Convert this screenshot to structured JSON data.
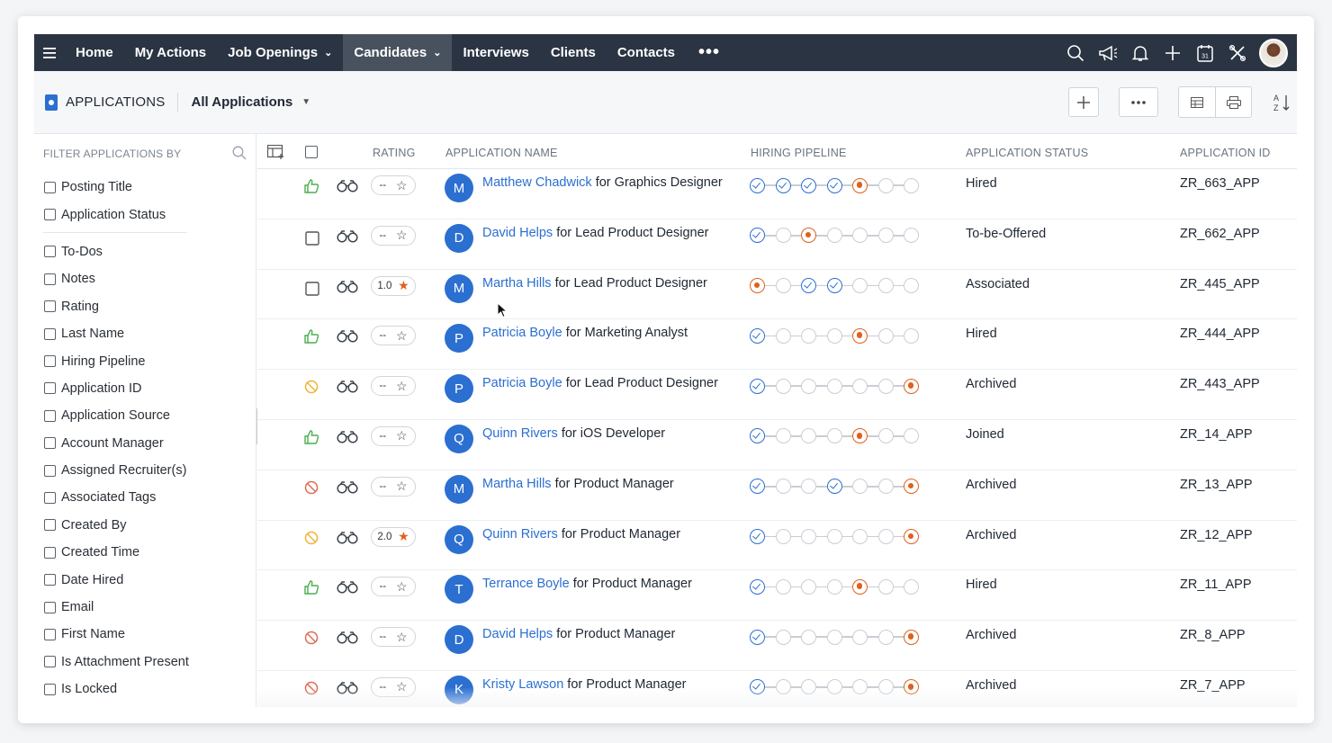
{
  "nav": {
    "items": [
      {
        "label": "Home"
      },
      {
        "label": "My Actions"
      },
      {
        "label": "Job Openings"
      },
      {
        "label": "Candidates"
      },
      {
        "label": "Interviews"
      },
      {
        "label": "Clients"
      },
      {
        "label": "Contacts"
      }
    ],
    "more_label": "•••",
    "active": "Candidates",
    "icons": [
      "search-icon",
      "announcement-icon",
      "bell-icon",
      "plus-icon",
      "calendar-icon",
      "tools-icon"
    ],
    "calendar_day": "31"
  },
  "toolbar": {
    "module_title": "APPLICATIONS",
    "view_label": "All Applications"
  },
  "sidebar": {
    "header": "FILTER APPLICATIONS BY",
    "group1": [
      {
        "label": "Posting Title"
      },
      {
        "label": "Application Status"
      }
    ],
    "group2": [
      {
        "label": "To-Dos"
      },
      {
        "label": "Notes"
      },
      {
        "label": "Rating"
      },
      {
        "label": "Last Name"
      },
      {
        "label": "Hiring Pipeline"
      },
      {
        "label": "Application ID"
      },
      {
        "label": "Application Source"
      },
      {
        "label": "Account Manager"
      },
      {
        "label": "Assigned Recruiter(s)"
      },
      {
        "label": "Associated Tags"
      },
      {
        "label": "Created By"
      },
      {
        "label": "Created Time"
      },
      {
        "label": "Date Hired"
      },
      {
        "label": "Email"
      },
      {
        "label": "First Name"
      },
      {
        "label": "Is Attachment Present"
      },
      {
        "label": "Is Locked"
      }
    ]
  },
  "table": {
    "headers": {
      "rating": "RATING",
      "name": "APPLICATION NAME",
      "pipeline": "HIRING PIPELINE",
      "status": "APPLICATION STATUS",
      "id": "APPLICATION ID"
    },
    "for_word": "for",
    "colors": {
      "link": "#2b6fd1",
      "accent": "#e0601c",
      "like": "#4caf50",
      "pending": "#f2b233",
      "reject": "#e06a55"
    },
    "rows": [
      {
        "mark": "like",
        "rating": "--",
        "star": false,
        "initial": "M",
        "candidate": "Matthew Chadwick",
        "job": "Graphics Designer",
        "pipeline": [
          "done",
          "done",
          "done",
          "done",
          "cur",
          "todo",
          "todo"
        ],
        "status": "Hired",
        "id": "ZR_663_APP"
      },
      {
        "mark": "checkbox",
        "rating": "--",
        "star": false,
        "initial": "D",
        "candidate": "David Helps",
        "job": "Lead Product Designer",
        "pipeline": [
          "done",
          "todo",
          "cur",
          "todo",
          "todo",
          "todo",
          "todo"
        ],
        "status": "To-be-Offered",
        "id": "ZR_662_APP"
      },
      {
        "mark": "checkbox",
        "rating": "1.0",
        "star": true,
        "initial": "M",
        "candidate": "Martha Hills",
        "job": "Lead Product Designer",
        "pipeline": [
          "cur",
          "todo",
          "done",
          "done",
          "todo",
          "todo",
          "todo"
        ],
        "status": "Associated",
        "id": "ZR_445_APP"
      },
      {
        "mark": "like",
        "rating": "--",
        "star": false,
        "initial": "P",
        "candidate": "Patricia Boyle",
        "job": "Marketing Analyst",
        "pipeline": [
          "done",
          "todo",
          "todo",
          "todo",
          "cur",
          "todo",
          "todo"
        ],
        "status": "Hired",
        "id": "ZR_444_APP"
      },
      {
        "mark": "pending",
        "rating": "--",
        "star": false,
        "initial": "P",
        "candidate": "Patricia Boyle",
        "job": "Lead Product Designer",
        "pipeline": [
          "done",
          "todo",
          "todo",
          "todo",
          "todo",
          "todo",
          "cur"
        ],
        "status": "Archived",
        "id": "ZR_443_APP"
      },
      {
        "mark": "like",
        "rating": "--",
        "star": false,
        "initial": "Q",
        "candidate": "Quinn Rivers",
        "job": "iOS Developer",
        "pipeline": [
          "done",
          "todo",
          "todo",
          "todo",
          "cur",
          "todo",
          "todo"
        ],
        "status": "Joined",
        "id": "ZR_14_APP"
      },
      {
        "mark": "reject",
        "rating": "--",
        "star": false,
        "initial": "M",
        "candidate": "Martha Hills",
        "job": "Product Manager",
        "pipeline": [
          "done",
          "todo",
          "todo",
          "done",
          "todo",
          "todo",
          "cur"
        ],
        "status": "Archived",
        "id": "ZR_13_APP"
      },
      {
        "mark": "pending",
        "rating": "2.0",
        "star": true,
        "initial": "Q",
        "candidate": "Quinn Rivers",
        "job": "Product Manager",
        "pipeline": [
          "done",
          "todo",
          "todo",
          "todo",
          "todo",
          "todo",
          "cur"
        ],
        "status": "Archived",
        "id": "ZR_12_APP"
      },
      {
        "mark": "like",
        "rating": "--",
        "star": false,
        "initial": "T",
        "candidate": "Terrance Boyle",
        "job": "Product Manager",
        "pipeline": [
          "done",
          "todo",
          "todo",
          "todo",
          "cur",
          "todo",
          "todo"
        ],
        "status": "Hired",
        "id": "ZR_11_APP"
      },
      {
        "mark": "reject",
        "rating": "--",
        "star": false,
        "initial": "D",
        "candidate": "David Helps",
        "job": "Product Manager",
        "pipeline": [
          "done",
          "todo",
          "todo",
          "todo",
          "todo",
          "todo",
          "cur"
        ],
        "status": "Archived",
        "id": "ZR_8_APP"
      },
      {
        "mark": "reject",
        "rating": "--",
        "star": false,
        "initial": "K",
        "candidate": "Kristy Lawson",
        "job": "Product Manager",
        "pipeline": [
          "done",
          "todo",
          "todo",
          "todo",
          "todo",
          "todo",
          "cur"
        ],
        "status": "Archived",
        "id": "ZR_7_APP"
      }
    ]
  }
}
